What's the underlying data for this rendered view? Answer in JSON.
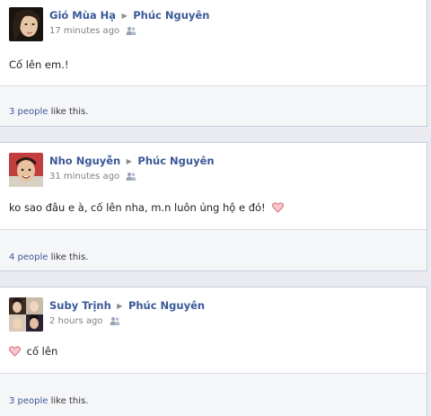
{
  "posts": [
    {
      "author": "Gió Mùa Hạ",
      "target": "Phúc Nguyên",
      "time": "17 minutes ago",
      "text": "Cố lên em.!",
      "likes_count": "3 people",
      "likes_suffix": " like this."
    },
    {
      "author": "Nho Nguyễn",
      "target": "Phúc Nguyên",
      "time": "31 minutes ago",
      "text": "ko sao đâu e à, cố lên nha, m.n luôn ủng hộ e đó!",
      "likes_count": "4 people",
      "likes_suffix": " like this."
    },
    {
      "author": "Suby Trịnh",
      "target": "Phúc Nguyên",
      "time": "2 hours ago",
      "text": "cố lên",
      "likes_count": "3 people",
      "likes_suffix": " like this."
    }
  ],
  "icons": {
    "separator": "arrow-right-icon",
    "audience": "friends-icon",
    "emoticon": "heart-icon"
  },
  "colors": {
    "link": "#3b5998",
    "heart": "#e07080"
  }
}
